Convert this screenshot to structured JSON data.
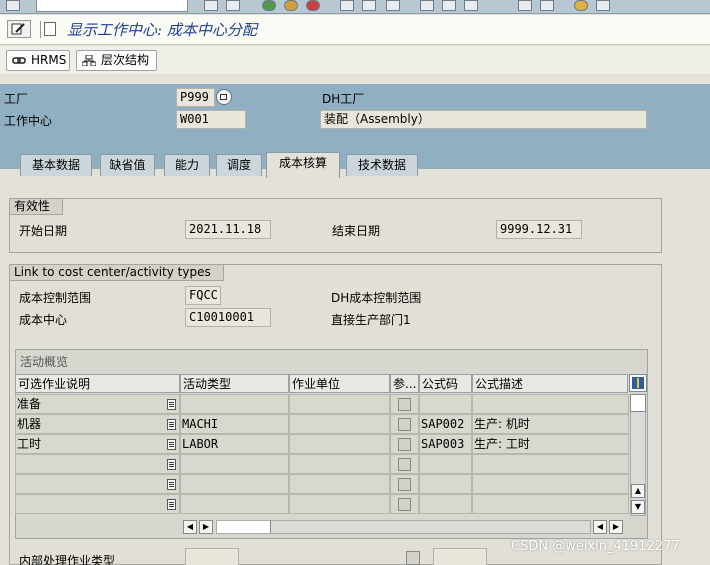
{
  "title": "显示工作中心: 成本中心分配",
  "toolbar": {
    "hrms_label": "HRMS",
    "hierarchy_label": "层次结构"
  },
  "header": {
    "plant_label": "工厂",
    "plant_value": "P999",
    "plant_desc": "DH工厂",
    "workcenter_label": "工作中心",
    "workcenter_value": "W001",
    "workcenter_desc": "装配（Assembly）"
  },
  "tabs": [
    "基本数据",
    "缺省值",
    "能力",
    "调度",
    "成本核算",
    "技术数据"
  ],
  "active_tab": "成本核算",
  "validity": {
    "title": "有效性",
    "start_label": "开始日期",
    "start_value": "2021.11.18",
    "end_label": "结束日期",
    "end_value": "9999.12.31"
  },
  "link": {
    "title": "Link to cost center/activity types",
    "area_label": "成本控制范围",
    "area_value": "FQCC",
    "area_desc": "DH成本控制范围",
    "cc_label": "成本中心",
    "cc_value": "C10010001",
    "cc_desc": "直接生产部门1"
  },
  "table": {
    "title": "活动概览",
    "headers": [
      "可选作业说明",
      "活动类型",
      "作业单位",
      "参...",
      "公式码",
      "公式描述"
    ],
    "rows": [
      [
        "准备",
        "",
        "",
        "",
        "",
        ""
      ],
      [
        "机器",
        "MACHI",
        "",
        "",
        "SAP002",
        "生产: 机时"
      ],
      [
        "工时",
        "LABOR",
        "",
        "",
        "SAP003",
        "生产: 工时"
      ],
      [
        "",
        "",
        "",
        "",
        "",
        ""
      ],
      [
        "",
        "",
        "",
        "",
        "",
        ""
      ],
      [
        "",
        "",
        "",
        "",
        "",
        ""
      ]
    ]
  },
  "footer_label": "内部处理作业类型",
  "watermark": "CSDN @weixin_41912277",
  "colors": {
    "header_bg": "#91afc2",
    "title_text": "#1f3f8f",
    "content_bg": "#e4e2d8"
  }
}
